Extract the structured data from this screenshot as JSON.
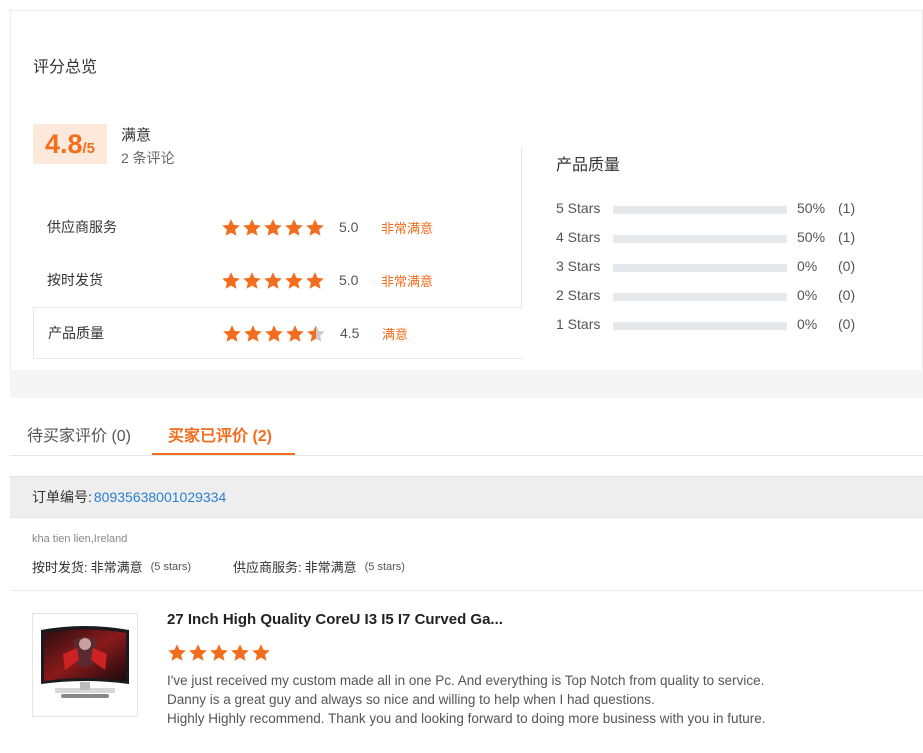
{
  "overview": {
    "title": "评分总览",
    "score": "4.8",
    "score_max": "/5",
    "score_label": "满意",
    "review_count": "2 条评论",
    "ratings": [
      {
        "label": "供应商服务",
        "stars": 5.0,
        "value": "5.0",
        "word": "非常满意"
      },
      {
        "label": "按时发货",
        "stars": 5.0,
        "value": "5.0",
        "word": "非常满意"
      },
      {
        "label": "产品质量",
        "stars": 4.5,
        "value": "4.5",
        "word": "满意"
      }
    ]
  },
  "distribution": {
    "title": "产品质量",
    "rows": [
      {
        "label": "5 Stars",
        "fraction": 0.5,
        "pct": "50%",
        "count": "(1)"
      },
      {
        "label": "4 Stars",
        "fraction": 0.5,
        "pct": "50%",
        "count": "(1)"
      },
      {
        "label": "3 Stars",
        "fraction": 0.0,
        "pct": "0%",
        "count": "(0)"
      },
      {
        "label": "2 Stars",
        "fraction": 0.0,
        "pct": "0%",
        "count": "(0)"
      },
      {
        "label": "1 Stars",
        "fraction": 0.0,
        "pct": "0%",
        "count": "(0)"
      }
    ]
  },
  "tabs": [
    {
      "label": "待买家评价 (0)",
      "active": false
    },
    {
      "label": "买家已评价 (2)",
      "active": true
    }
  ],
  "order": {
    "label": "订单编号:",
    "id": "80935638001029334"
  },
  "review": {
    "reviewer": "kha tien lien,Ireland",
    "sub_ratings": [
      {
        "label": "按时发货:",
        "value": "非常满意",
        "stars": "(5 stars)"
      },
      {
        "label": "供应商服务:",
        "value": "非常满意",
        "stars": "(5 stars)"
      }
    ],
    "product_title": "27 Inch High Quality CoreU I3 I5 I7 Curved Ga...",
    "stars": 5,
    "text_lines": [
      "I've just received my custom made all in one Pc. And everything is Top Notch from quality to service.",
      "Danny is a great guy and always so nice and willing to help when I had questions.",
      "Highly Highly recommend. Thank you and looking forward to doing more business with you in future."
    ]
  },
  "colors": {
    "accent": "#f26d1e",
    "star_empty": "#cccccc",
    "link": "#2c7fd1"
  },
  "icons": {
    "star": "star-icon",
    "half_star": "half-star-icon",
    "product_thumbnail": "curved-monitor-image"
  }
}
